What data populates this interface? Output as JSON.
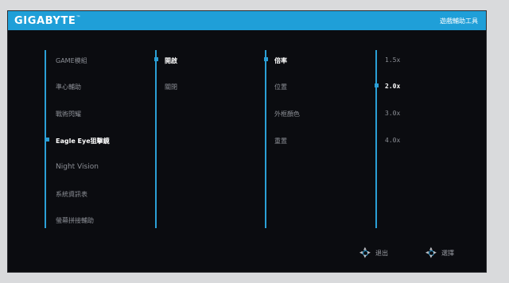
{
  "header": {
    "brand": "GIGABYTE",
    "tm": "™",
    "tool_title": "遊戲輔助工具"
  },
  "menu": {
    "col1": [
      "GAME模組",
      "準心輔助",
      "戰術閃耀",
      "Eagle Eye狙擊鏡",
      "Night Vision",
      "系統資訊表",
      "螢幕拼接輔助"
    ],
    "col1_selected_index": 3,
    "col2": [
      "開啟",
      "關閉"
    ],
    "col2_selected_index": 0,
    "col3": [
      "倍率",
      "位置",
      "外框顏色",
      "重置"
    ],
    "col3_selected_index": 0,
    "col4": [
      "1.5x",
      "2.0x",
      "3.0x",
      "4.0x"
    ],
    "col4_selected_index": 1
  },
  "footer": {
    "exit_label": "退出",
    "select_label": "選擇"
  },
  "colors": {
    "accent": "#2b9fd6",
    "header": "#1f9fd8",
    "panel": "#0b0c10"
  }
}
